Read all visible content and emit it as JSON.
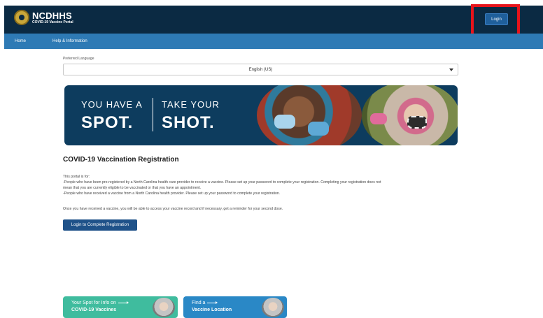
{
  "header": {
    "logo_title": "NCDHHS",
    "logo_subtitle": "COVID-19 Vaccine Portal",
    "login_label": "Login"
  },
  "nav": {
    "items": [
      {
        "label": "Home"
      },
      {
        "label": "Help & Information"
      }
    ]
  },
  "language": {
    "label": "Preferred Language",
    "selected": "English (US)"
  },
  "banner": {
    "line1_left": "YOU HAVE A",
    "line2_left": "SPOT.",
    "line1_right": "TAKE YOUR",
    "line2_right": "SHOT."
  },
  "registration": {
    "title": "COVID-19 Vaccination Registration",
    "intro": "This portal is for:",
    "bullet1_a": "-People who have been pre-registered by a North Carolina health care provider to receive a vaccine. Please set up your password to complete your registration. Completing your registration does not",
    "bullet1_b": "mean that you are currently eligible to be vaccinated or that you have an appointment.",
    "bullet2": "-People who have received a vaccine from a North Carolina health provider. Please set up your password to complete your registration.",
    "note": "Once you have received a vaccine, you will be able to access your vaccine record and if necessary, get a reminder for your second dose.",
    "button": "Login to Complete Registration"
  },
  "cards": [
    {
      "small": "Your Spot for Info on",
      "big": "COVID-19 Vaccines"
    },
    {
      "small": "Find a",
      "big": "Vaccine Location"
    }
  ],
  "colors": {
    "header_bg": "#0b2a43",
    "nav_bg": "#2e7ab5",
    "highlight": "#e8141b",
    "button_bg": "#1f5289"
  }
}
